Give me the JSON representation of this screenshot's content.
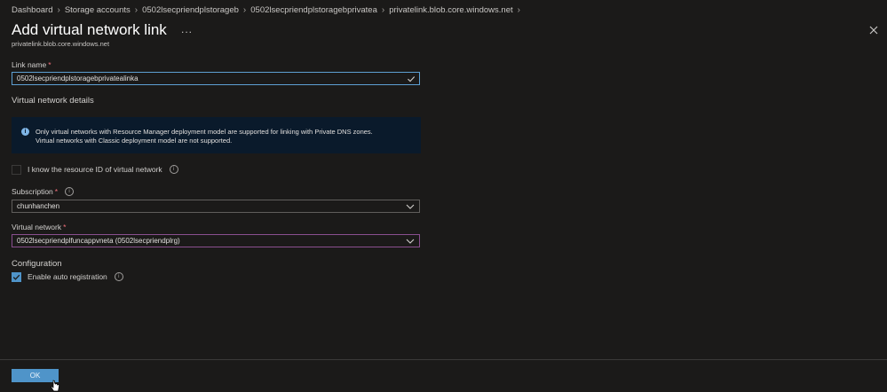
{
  "breadcrumb": [
    {
      "label": "Dashboard"
    },
    {
      "label": "Storage accounts"
    },
    {
      "label": "0502lsecpriendplstorageb"
    },
    {
      "label": "0502lsecpriendplstoragebprivatea"
    },
    {
      "label": "privatelink.blob.core.windows.net"
    }
  ],
  "header": {
    "title": "Add virtual network link",
    "more": "...",
    "subtitle": "privatelink.blob.core.windows.net"
  },
  "form": {
    "link_name_label": "Link name",
    "link_name_value": "0502lsecpriendplstoragebprivatealinka",
    "required_mark": "*",
    "vnet_details_heading": "Virtual network details",
    "info_line1": "Only virtual networks with Resource Manager deployment model are supported for linking with Private DNS zones.",
    "info_line2": "Virtual networks with Classic deployment model are not supported.",
    "resource_id_label": "I know the resource ID of virtual network",
    "subscription_label": "Subscription",
    "subscription_value": "chunhanchen",
    "vnet_label": "Virtual network",
    "vnet_value": "0502lsecpriendplfuncappvneta (0502lsecpriendplrg)",
    "configuration_heading": "Configuration",
    "auto_registration_label": "Enable auto registration",
    "resource_id_checked": false,
    "auto_registration_checked": true
  },
  "footer": {
    "ok_label": "OK"
  },
  "icons": {
    "info": "i"
  },
  "colors": {
    "accent": "#4f94c9",
    "background": "#1b1a19",
    "required": "#f1707b",
    "infobox": "#0a1a2b"
  }
}
